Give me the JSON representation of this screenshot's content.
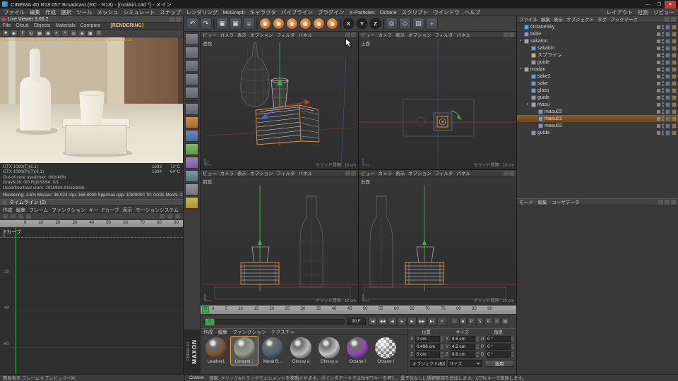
{
  "titlebar": {
    "title": "CINEMA 4D R18.057 Broadcast (RC - R18) - [mokkiri.c4d *] - メイン",
    "minimize": "—",
    "maximize": "❐",
    "close": "✕"
  },
  "menubar": {
    "items": [
      "ファイル",
      "編集",
      "作成",
      "選択",
      "ツール",
      "メッシュ",
      "シミュレート",
      "スナップ",
      "レンダリング",
      "MoGraph",
      "キャラクタ",
      "パイプライン",
      "プラグイン",
      "X-Particles",
      "Octane",
      "スクリプト",
      "ウインドウ",
      "ヘルプ"
    ],
    "right_items": [
      "レイアウト",
      "社割",
      "リビュー"
    ]
  },
  "live_viewer": {
    "title": "Live Viewer 3.06.2",
    "menu": [
      "File",
      "Cloud",
      "Objects",
      "Materials",
      "Compare"
    ],
    "rendering_badge": "[RENDERING]",
    "tools": [
      {
        "name": "stop-render-icon",
        "g": "■"
      },
      {
        "name": "restart-render-icon",
        "g": "▶"
      },
      {
        "name": "pause-render-icon",
        "g": "‖"
      },
      {
        "name": "reset-render-icon",
        "g": "↻"
      },
      {
        "name": "region-render-icon",
        "g": "▦"
      },
      {
        "name": "focus-pick-icon",
        "g": "◉"
      },
      {
        "name": "white-balance-icon",
        "g": "◐"
      },
      {
        "name": "add-render-target-icon",
        "g": "+"
      },
      {
        "name": "lock-resolution-icon",
        "g": "◎"
      },
      {
        "name": "material-pick-icon",
        "g": "◈"
      },
      {
        "name": "save-image-icon",
        "g": "▣"
      },
      {
        "name": "settings-icon",
        "g": "≡"
      }
    ],
    "overlay_info": "CheckIdms,10ms, MeshGeo0ms, LivUpdt1M10ms, Nodes41 Movable11 0.0",
    "gpu_stats": [
      {
        "label": "GTX 1080(T)(6.1)",
        "clock": "1693",
        "temp": "72°C"
      },
      {
        "label": "GTX 1080(P)(T)(6.1)",
        "clock": "1694",
        "temp": "64°C"
      }
    ],
    "stat_lines": [
      "Out-of-core used/max: 0Kb/4Gb",
      "Gray8/16: 0/0    Rgb32/64: 0/1",
      "Used/free/total vram: 291Mb/6.91Gb/8Gb"
    ],
    "progress_line": "Rendering: 1.6%   Ms/sec: 36.023   s/px 166.8000   Spp/max spp: 108/8000   Tri: 0/22k   Meshl: 11"
  },
  "timeline_panel": {
    "title": "タイムライン (2)",
    "menu": [
      "作成",
      "編集",
      "フレーム",
      "ファンクション",
      "キー",
      "Fカーブ",
      "表示",
      "モーションシステム"
    ],
    "ruler_ticks": [
      "0",
      "10",
      "20",
      "30",
      "40",
      "50",
      "60",
      "70",
      "80",
      "90"
    ],
    "track_label": "Fカーブ",
    "value_ticks": [
      "0",
      "-20",
      "-40",
      "-60"
    ]
  },
  "main_toolbar": {
    "icons": [
      {
        "name": "undo-icon",
        "g": "↶"
      },
      {
        "name": "redo-icon",
        "g": "↷"
      },
      {
        "name": "toolbar-separator",
        "cls": "sep"
      },
      {
        "name": "render-view-icon",
        "g": "▣"
      },
      {
        "name": "render-region-icon",
        "g": "▣"
      },
      {
        "name": "render-settings-icon",
        "g": "≡"
      },
      {
        "name": "toolbar-separator",
        "cls": "sep"
      },
      {
        "name": "octane-liveviewer-icon",
        "g": "◉",
        "cls": "oc"
      },
      {
        "name": "octane-scene-icon",
        "g": "◉",
        "cls": "oc"
      },
      {
        "name": "octane-camera-icon",
        "g": "◉",
        "cls": "oc"
      },
      {
        "name": "octane-environment-icon",
        "g": "◉",
        "cls": "oc"
      },
      {
        "name": "octane-material-icon",
        "g": "◉",
        "cls": "oc"
      },
      {
        "name": "octane-settings-icon",
        "g": "◉",
        "cls": "oc"
      },
      {
        "name": "toolbar-separator",
        "cls": "sep"
      },
      {
        "name": "axis-x-button",
        "g": "X",
        "cls": "xyz"
      },
      {
        "name": "axis-y-button",
        "g": "Y",
        "cls": "xyz"
      },
      {
        "name": "axis-z-button",
        "g": "Z",
        "cls": "xyz"
      },
      {
        "name": "toolbar-separator",
        "cls": "sep"
      },
      {
        "name": "coord-system-button",
        "g": "◎"
      },
      {
        "name": "snap-button",
        "g": "◇"
      },
      {
        "name": "workplane-button",
        "g": "▤"
      },
      {
        "name": "modeling-axis-button",
        "g": "+"
      }
    ]
  },
  "tool_palette": {
    "tools": [
      {
        "name": "live-selection-tool",
        "color": "#6b7078"
      },
      {
        "name": "move-tool",
        "color": "#6b7078"
      },
      {
        "name": "scale-tool",
        "color": "#6b7078"
      },
      {
        "name": "rotate-tool",
        "color": "#6b7078"
      },
      {
        "name": "last-tool-button",
        "color": "#6b7078"
      },
      {
        "name": "palette-separator",
        "cls": "sep"
      },
      {
        "name": "pen-tool",
        "color": "#6b7078"
      },
      {
        "name": "cube-primitive-button",
        "color": "#c77b2e"
      },
      {
        "name": "spline-primitive-button",
        "color": "#4a7ab5"
      },
      {
        "name": "generator-button",
        "color": "#6fae4a"
      },
      {
        "name": "deformer-button",
        "color": "#8e6ab8"
      },
      {
        "name": "floor-button",
        "color": "#5b8a8f"
      },
      {
        "name": "camera-button",
        "color": "#80858c"
      },
      {
        "name": "light-button",
        "color": "#c9a93a"
      }
    ]
  },
  "viewports": {
    "menu": [
      "ビュー",
      "カメラ",
      "表示",
      "オプション",
      "フィルタ",
      "パネル"
    ],
    "persp_label": "透視",
    "top_label": "上面",
    "front_label": "前面",
    "right_label": "右面",
    "grid_label": "グリッド間隔 : 10 cm"
  },
  "anim": {
    "ticks": [
      "0",
      "5",
      "10",
      "15",
      "20",
      "25",
      "30",
      "35",
      "40",
      "45",
      "50",
      "55",
      "60",
      "65",
      "70",
      "75",
      "80",
      "85",
      "90"
    ],
    "playhead": "0",
    "end_frame": "90 F",
    "transport": [
      {
        "name": "goto-start-button",
        "g": "|◀"
      },
      {
        "name": "prev-key-button",
        "g": "◀◀"
      },
      {
        "name": "prev-frame-button",
        "g": "◀"
      },
      {
        "name": "play-button",
        "g": "▶",
        "cls": "play"
      },
      {
        "name": "next-frame-button",
        "g": "▶"
      },
      {
        "name": "next-key-button",
        "g": "▶▶"
      },
      {
        "name": "goto-end-button",
        "g": "▶|"
      },
      {
        "name": "loop-button",
        "g": "↻"
      }
    ],
    "record": [
      {
        "name": "record-keyframe-button",
        "g": "●",
        "cls": "rec"
      },
      {
        "name": "autokey-button",
        "g": "◆"
      },
      {
        "name": "record-position-button",
        "g": "P"
      },
      {
        "name": "record-scale-button",
        "g": "S"
      },
      {
        "name": "record-rotation-button",
        "g": "R"
      },
      {
        "name": "record-param-button",
        "g": "◇"
      },
      {
        "name": "record-pla-button",
        "g": "▤"
      }
    ]
  },
  "materials": {
    "logo_primary": "MAXON",
    "logo_secondary": "CINEMA 4D",
    "menu": [
      "作成",
      "編集",
      "ファンクション",
      "テクスチャ"
    ],
    "items": [
      {
        "label": "Leather1",
        "color": "#7a5233"
      },
      {
        "label": "Concret...",
        "color": "#9a9a92",
        "selected": true
      },
      {
        "label": "Metal B...",
        "color": "#55606a"
      },
      {
        "label": "Glossy a",
        "color": "#b9b9b9"
      },
      {
        "label": "Glossy a",
        "color": "#c2c2c2"
      },
      {
        "label": "Octane l",
        "color": "#8d4bb0"
      },
      {
        "label": "Octane l",
        "color": "#cfcfcf",
        "cls": "checker"
      }
    ]
  },
  "coordinates": {
    "headers": [
      "位置",
      "サイズ",
      "角度"
    ],
    "position": [
      {
        "ax": "X",
        "v": "0 cm"
      },
      {
        "ax": "Y",
        "v": "0.496 cm"
      },
      {
        "ax": "Z",
        "v": "0 cm"
      }
    ],
    "size": [
      {
        "ax": "X",
        "v": "8.6 cm"
      },
      {
        "ax": "Y",
        "v": "4.5 cm"
      },
      {
        "ax": "Z",
        "v": "8.6 cm"
      }
    ],
    "rotation": [
      {
        "ax": "H",
        "v": "0 °"
      },
      {
        "ax": "P",
        "v": "0 °"
      },
      {
        "ax": "B",
        "v": "0 °"
      }
    ],
    "transform_dropdown": "オブジェクト(相対)",
    "size_dropdown": "サイズ",
    "apply_button": "適用"
  },
  "object_manager": {
    "menu": [
      "ファイル",
      "編集",
      "表示",
      "オブジェクト",
      "タグ",
      "ブックマーク"
    ],
    "items": [
      {
        "label": "OctaneSky",
        "depth": 0,
        "color": "#5aa8d8"
      },
      {
        "label": "table",
        "depth": 0,
        "color": "#7a9cc4"
      },
      {
        "label": "sakaton",
        "depth": 0,
        "color": "#a8a8a8",
        "cls": "grp"
      },
      {
        "label": "sakabin",
        "depth": 1,
        "color": "#7a9cc4"
      },
      {
        "label": "スプライン",
        "depth": 1,
        "color": "#c4b27a"
      },
      {
        "label": "guide",
        "depth": 1,
        "color": "#9a9a9a"
      },
      {
        "label": "modan",
        "depth": 0,
        "color": "#a8a8a8",
        "cls": "grp"
      },
      {
        "label": "sake2",
        "depth": 1,
        "color": "#7a9cc4"
      },
      {
        "label": "sake",
        "depth": 1,
        "color": "#7a9cc4"
      },
      {
        "label": "glass",
        "depth": 1,
        "color": "#7a9cc4"
      },
      {
        "label": "guide",
        "depth": 1,
        "color": "#9a9a9a"
      },
      {
        "label": "masu",
        "depth": 1,
        "color": "#a8a8a8",
        "cls": "grp"
      },
      {
        "label": "masu02",
        "depth": 2,
        "color": "#7a9cc4"
      },
      {
        "label": "masu01",
        "depth": 2,
        "color": "#7a9cc4",
        "selected": true
      },
      {
        "label": "masu02",
        "depth": 2,
        "color": "#7a9cc4"
      },
      {
        "label": "guide",
        "depth": 1,
        "color": "#9a9a9a"
      }
    ]
  },
  "attribute_manager": {
    "menu": [
      "モード",
      "編集",
      "ユーザデータ"
    ]
  },
  "statusbar": {
    "left": "簡易表示 フレーム 0 プレビュ 0～90",
    "octane_label": "Octane:",
    "message": "情報: クリック&ドラッグでエレメントを移動させます。ポインタモードではSHIFTキーを押し、量子化なしに選択範囲を追加します。CTRLキーで削除します。"
  }
}
